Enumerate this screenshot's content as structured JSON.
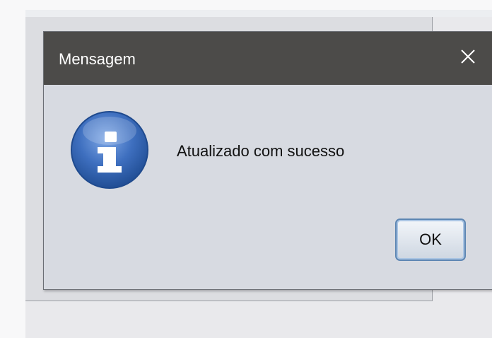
{
  "dialog": {
    "title": "Mensagem",
    "message": "Atualizado com sucesso",
    "ok_label": "OK",
    "icon": "information-icon",
    "close_icon": "close-icon"
  },
  "colors": {
    "titlebar": "#4c4b49",
    "dialog_body": "#d7dae1",
    "icon_blue": "#2f5ea8",
    "button_border": "#5d86b3"
  }
}
